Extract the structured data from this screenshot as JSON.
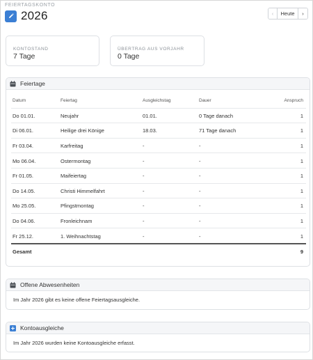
{
  "header": {
    "eyebrow": "FEIERTAGSKONTO",
    "year": "2026",
    "nav": {
      "prev": "‹",
      "today": "Heute",
      "next": "›"
    }
  },
  "stats": [
    {
      "label": "KONTOSTAND",
      "value": "7 Tage"
    },
    {
      "label": "ÜBERTRAG AUS VORJAHR",
      "value": "0 Tage"
    }
  ],
  "holidays": {
    "title": "Feiertage",
    "columns": {
      "date": "Datum",
      "name": "Feiertag",
      "ausgleich": "Ausgleichstag",
      "dauer": "Dauer",
      "anspruch": "Anspruch"
    },
    "rows": [
      {
        "date": "Do 01.01.",
        "name": "Neujahr",
        "ausgleich": "01.01.",
        "dauer": "0 Tage danach",
        "anspruch": "1"
      },
      {
        "date": "Di 06.01.",
        "name": "Heilige drei Könige",
        "ausgleich": "18.03.",
        "dauer": "71 Tage danach",
        "anspruch": "1"
      },
      {
        "date": "Fr 03.04.",
        "name": "Karfreitag",
        "ausgleich": "-",
        "dauer": "-",
        "anspruch": "1"
      },
      {
        "date": "Mo 06.04.",
        "name": "Ostermontag",
        "ausgleich": "-",
        "dauer": "-",
        "anspruch": "1"
      },
      {
        "date": "Fr 01.05.",
        "name": "Maifeiertag",
        "ausgleich": "-",
        "dauer": "-",
        "anspruch": "1"
      },
      {
        "date": "Do 14.05.",
        "name": "Christi Himmelfahrt",
        "ausgleich": "-",
        "dauer": "-",
        "anspruch": "1"
      },
      {
        "date": "Mo 25.05.",
        "name": "Pfingstmontag",
        "ausgleich": "-",
        "dauer": "-",
        "anspruch": "1"
      },
      {
        "date": "Do 04.06.",
        "name": "Fronleichnam",
        "ausgleich": "-",
        "dauer": "-",
        "anspruch": "1"
      },
      {
        "date": "Fr 25.12.",
        "name": "1. Weihnachtstag",
        "ausgleich": "-",
        "dauer": "-",
        "anspruch": "1"
      }
    ],
    "total_label": "Gesamt",
    "total_value": "9"
  },
  "open_absences": {
    "title": "Offene Abwesenheiten",
    "text": "Im Jahr 2026 gibt es keine offene Feiertagsausgleiche."
  },
  "account_adjustments": {
    "title": "Kontoausgleiche",
    "text": "Im Jahr 2026 wurden keine Kontoausgleiche erfasst."
  },
  "colors": {
    "accent": "#3b7fd4",
    "panel_header": "#f5f6f8"
  },
  "icons": {
    "edit": "pencil-icon",
    "calendar": "calendar-icon",
    "plus": "plus-icon"
  }
}
